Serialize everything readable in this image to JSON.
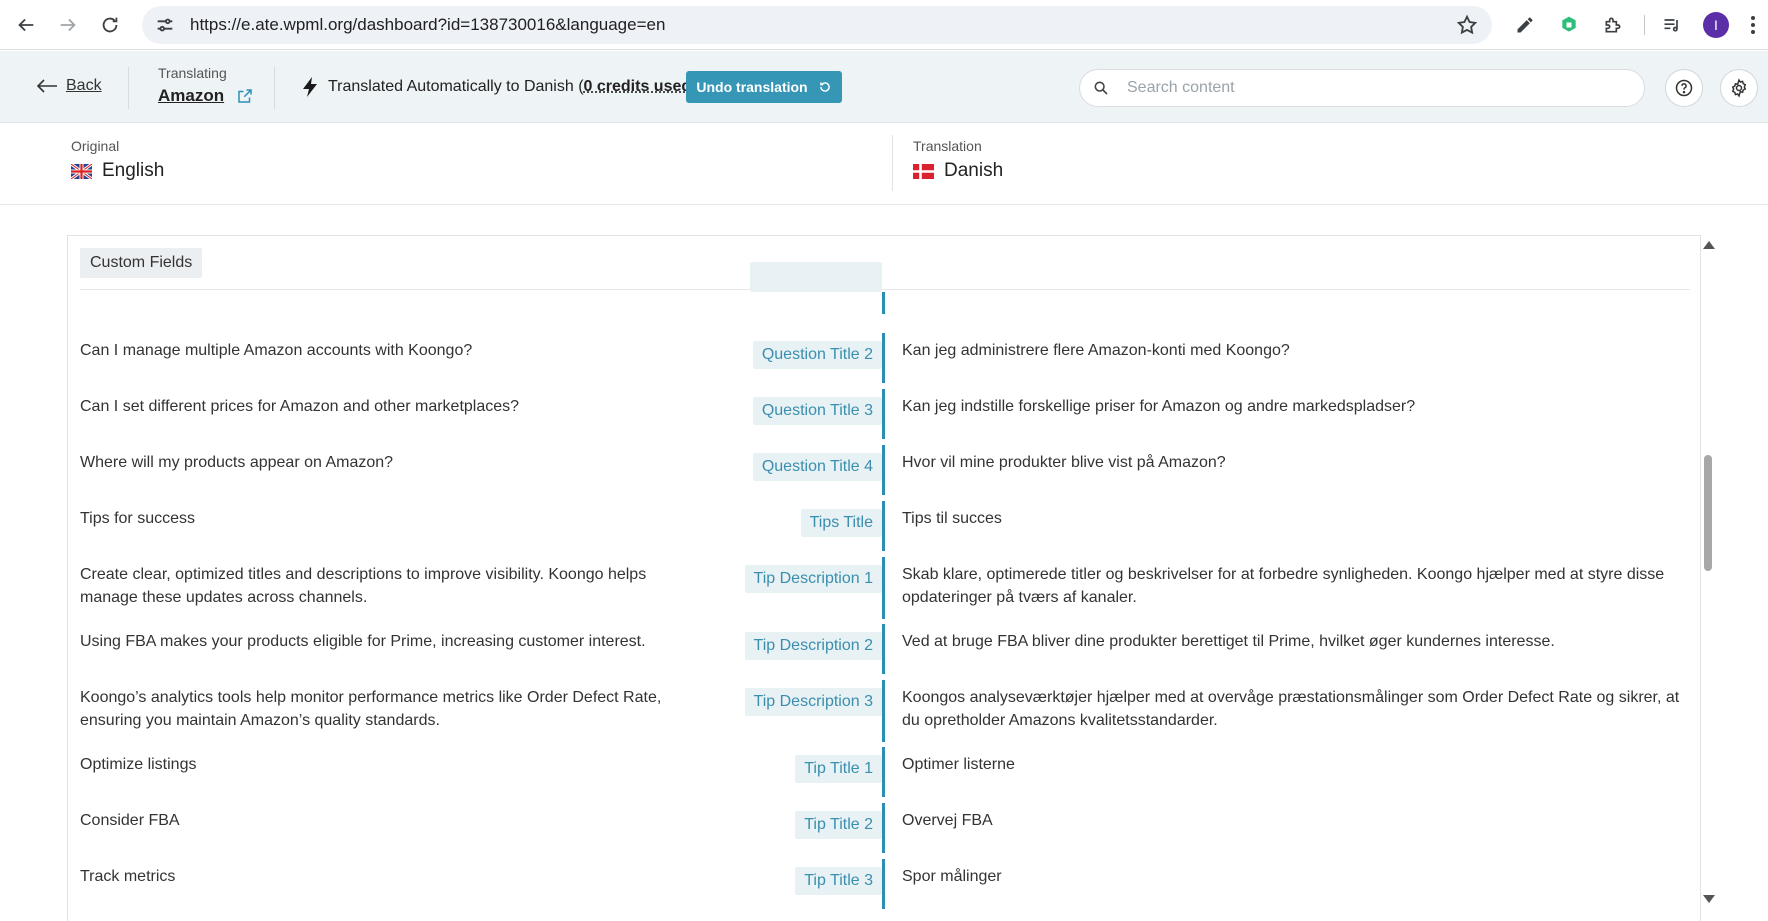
{
  "browser": {
    "url": "https://e.ate.wpml.org/dashboard?id=138730016&language=en",
    "avatar_letter": "I"
  },
  "header": {
    "back_label": "Back",
    "translating_label": "Translating",
    "job_name": "Amazon",
    "status_prefix": "Translated Automatically to Danish (",
    "credits": "0 credits used",
    "status_suffix": ")",
    "undo_label": "Undo translation",
    "search_placeholder": "Search content"
  },
  "languages": {
    "original_label": "Original",
    "original_name": "English",
    "translation_label": "Translation",
    "translation_name": "Danish"
  },
  "section": {
    "title": "Custom Fields"
  },
  "rows": [
    {
      "original": "Can I manage multiple Amazon accounts with Koongo?",
      "field": "Question Title 2",
      "translation": "Kan jeg administrere flere Amazon-konti med Koongo?"
    },
    {
      "original": "Can I set different prices for Amazon and other marketplaces?",
      "field": "Question Title 3",
      "translation": "Kan jeg indstille forskellige priser for Amazon og andre markedspladser?"
    },
    {
      "original": "Where will my products appear on Amazon?",
      "field": "Question Title 4",
      "translation": "Hvor vil mine produkter blive vist på Amazon?"
    },
    {
      "original": "Tips for success",
      "field": "Tips Title",
      "translation": "Tips til succes"
    },
    {
      "original": "Create clear, optimized titles and descriptions to improve visibility. Koongo helps manage these updates across channels.",
      "field": "Tip Description 1",
      "translation": "Skab klare, optimerede titler og beskrivelser for at forbedre synligheden. Koongo hjælper med at styre disse opdateringer på tværs af kanaler."
    },
    {
      "original": "Using FBA makes your products eligible for Prime, increasing customer interest.",
      "field": "Tip Description 2",
      "translation": "Ved at bruge FBA bliver dine produkter berettiget til Prime, hvilket øger kundernes interesse."
    },
    {
      "original": "Koongo’s analytics tools help monitor performance metrics like Order Defect Rate, ensuring you maintain Amazon’s quality standards.",
      "field": "Tip Description 3",
      "translation": "Koongos analyseværktøjer hjælper med at overvåge præstationsmålinger som Order Defect Rate og sikrer, at du opretholder Amazons kvalitetsstandarder."
    },
    {
      "original": "Optimize listings",
      "field": "Tip Title 1",
      "translation": "Optimer listerne"
    },
    {
      "original": "Consider FBA",
      "field": "Tip Title 2",
      "translation": "Overvej FBA"
    },
    {
      "original": "Track metrics",
      "field": "Tip Title 3",
      "translation": "Spor målinger"
    }
  ],
  "colors": {
    "accent": "#3596b5",
    "tag_text": "#3a8fae",
    "tag_bg": "#e8f1f4",
    "header_bg": "#eef3f5"
  }
}
